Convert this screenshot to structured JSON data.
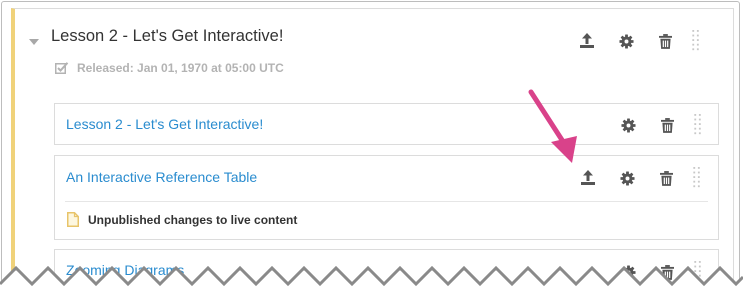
{
  "section": {
    "title": "Lesson 2 - Let's Get Interactive!",
    "release_status": "Released: Jan 01, 1970 at 05:00 UTC"
  },
  "units": [
    {
      "title": "Lesson 2 - Let's Get Interactive!"
    },
    {
      "title": "An Interactive Reference Table",
      "status": "Unpublished changes to live content"
    },
    {
      "title": "Zooming Diagrams"
    }
  ],
  "icons": {
    "expand": "chevron-down-icon",
    "publish": "upload-icon",
    "settings": "gear-icon",
    "delete": "trash-icon",
    "drag": "drag-handle-icon",
    "released": "checkbox-icon",
    "status": "document-icon"
  },
  "colors": {
    "accent_bar": "#f0d27a",
    "link": "#2a8ccf",
    "annotation_arrow": "#d9428a"
  }
}
